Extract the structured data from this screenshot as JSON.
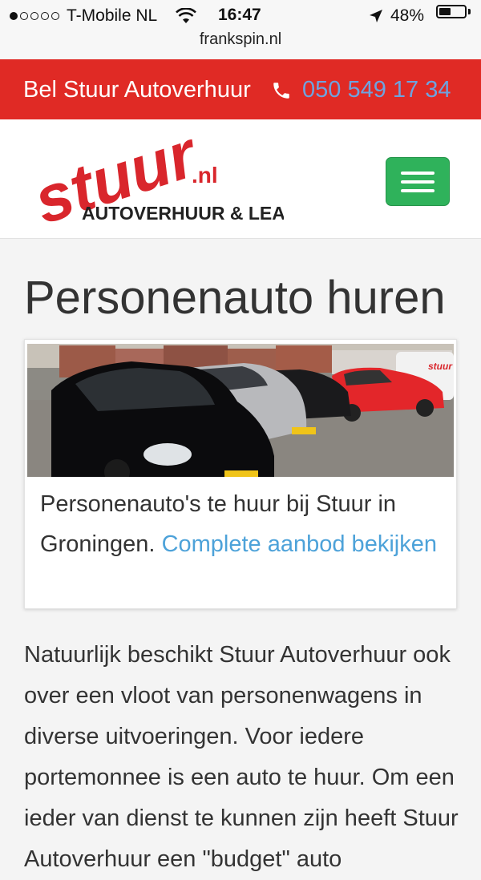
{
  "status_bar": {
    "carrier": "T-Mobile NL",
    "time": "16:47",
    "battery": "48%",
    "battery_level": 0.48,
    "signal_bars": 1,
    "url": "frankspin.nl"
  },
  "call_bar": {
    "label": "Bel Stuur Autoverhuur",
    "phone": "050 549 17 34",
    "icon": "phone-icon",
    "bg_color": "#e02a25",
    "phone_color": "#6ea3df"
  },
  "logo": {
    "word": "stuur",
    "tld": ".nl",
    "tagline": "AUTOVERHUUR & LEAS"
  },
  "menu_button": {
    "icon": "hamburger-icon",
    "color": "#2fb25b"
  },
  "page": {
    "title": "Personenauto huren",
    "card": {
      "caption": "Personenauto's te huur bij Stuur in Groningen.",
      "link": "Complete aanbod bekijken"
    },
    "intro": "Natuurlijk beschikt Stuur Autoverhuur ook over een vloot van personenwagens in diverse uitvoeringen. Voor iedere portemonnee is een auto te huur. Om een ieder van dienst te kunnen zijn heeft Stuur Autoverhuur een \"budget\" auto"
  }
}
